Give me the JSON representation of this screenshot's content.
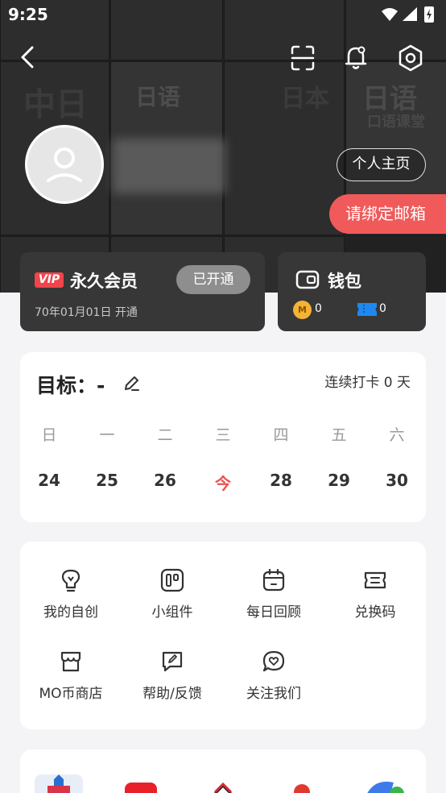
{
  "status_bar": {
    "time": "9:25"
  },
  "header": {
    "background_tile_texts": [
      "日语",
      "日本",
      "日语",
      "中日",
      "口语课堂"
    ],
    "homepage_label": "个人主页",
    "bind_email_label": "请绑定邮箱"
  },
  "vip": {
    "badge": "VIP",
    "title": "永久会员",
    "status": "已开通",
    "date": "70年01月01日 开通"
  },
  "wallet": {
    "title": "钱包",
    "coin_symbol": "M",
    "coin_count": "0",
    "ticket_count": "0"
  },
  "goal": {
    "title": "目标：-",
    "checkin": "连续打卡 0 天",
    "weekdays": [
      "日",
      "一",
      "二",
      "三",
      "四",
      "五",
      "六"
    ],
    "days": [
      "24",
      "25",
      "26",
      "今",
      "28",
      "29",
      "30"
    ]
  },
  "tools": [
    {
      "label": "我的自创",
      "icon": "lightbulb-icon"
    },
    {
      "label": "小组件",
      "icon": "widget-icon"
    },
    {
      "label": "每日回顾",
      "icon": "calendar-icon"
    },
    {
      "label": "兑换码",
      "icon": "ticket-icon"
    },
    {
      "label": "MO币商店",
      "icon": "store-icon"
    },
    {
      "label": "帮助/反馈",
      "icon": "feedback-icon"
    },
    {
      "label": "关注我们",
      "icon": "heart-chat-icon"
    }
  ],
  "colors": {
    "accent_red": "#f05a5a",
    "vip_badge": "#f0454b",
    "card_dark": "#373737",
    "coin": "#f5b335",
    "ticket": "#1e88f0"
  }
}
